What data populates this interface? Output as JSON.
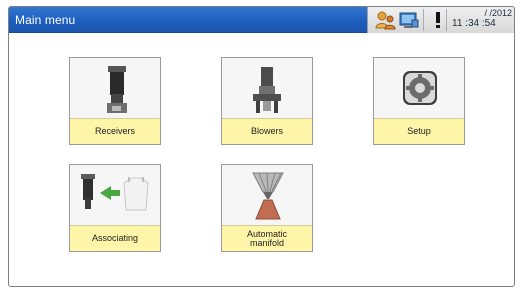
{
  "window": {
    "title": "Main menu"
  },
  "status": {
    "date": "/ /2012",
    "time": "11 :34 :54",
    "icons": [
      "user-icon",
      "screen-icon",
      "warning-icon"
    ]
  },
  "menu": {
    "items": [
      {
        "label": "Receivers",
        "icon": "receiver-icon"
      },
      {
        "label": "Blowers",
        "icon": "blower-icon"
      },
      {
        "label": "Setup",
        "icon": "gear-icon"
      },
      {
        "label": "Associating",
        "icon": "associating-icon"
      },
      {
        "label": "Automatic\nmanifold",
        "icon": "manifold-icon"
      }
    ]
  },
  "colors": {
    "titlebar": "#1f5fbf",
    "tile_label": "#fff5a8",
    "status_panel": "#d8d8d8"
  }
}
